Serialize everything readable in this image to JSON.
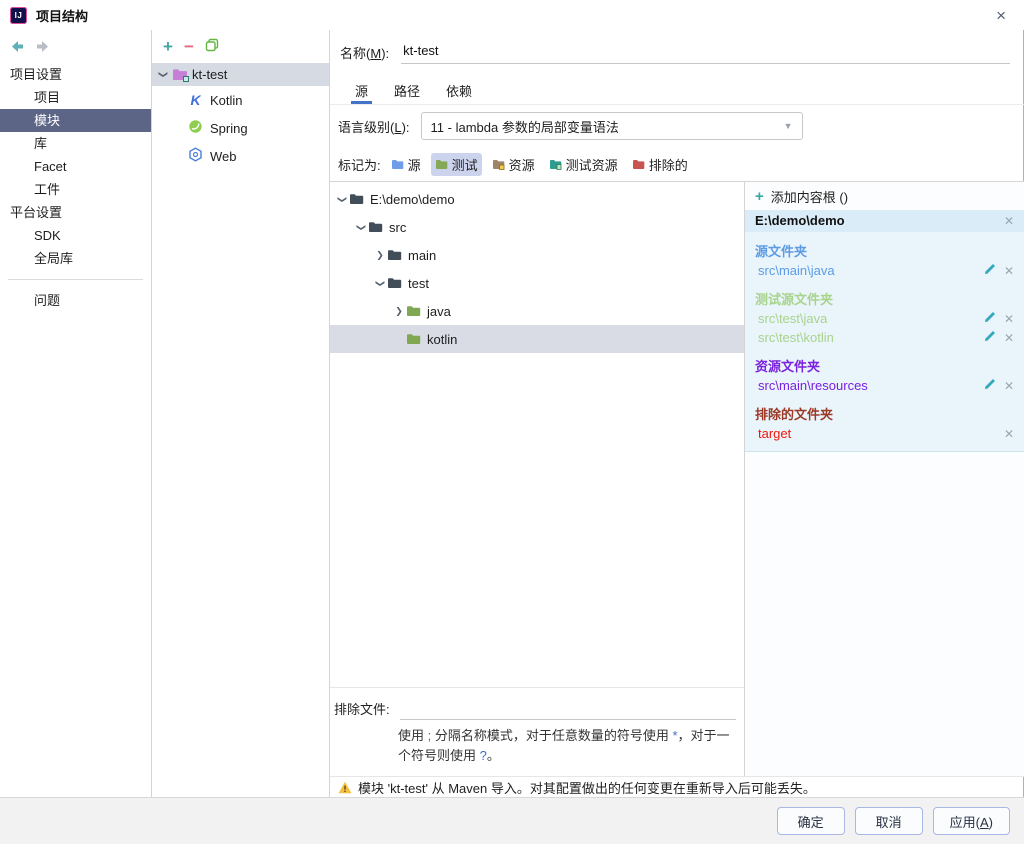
{
  "dialog": {
    "title": "项目结构"
  },
  "sidebar": {
    "sections": [
      {
        "header": "项目设置",
        "items": [
          "项目",
          "模块",
          "库",
          "Facet",
          "工件"
        ]
      },
      {
        "header": "平台设置",
        "items": [
          "SDK",
          "全局库"
        ]
      }
    ],
    "problems": "问题",
    "selected_item": "模块"
  },
  "modules_panel": {
    "root": "kt-test",
    "children": [
      "Kotlin",
      "Spring",
      "Web"
    ]
  },
  "editor": {
    "name_label": {
      "pre": "名称(",
      "mnemonic": "M",
      "post": "):"
    },
    "name_value": "kt-test",
    "tabs": [
      "源",
      "路径",
      "依赖"
    ],
    "active_tab": "源",
    "lang_label": {
      "pre": "语言级别(",
      "mnemonic": "L",
      "post": "):"
    },
    "lang_value": "11 - lambda 参数的局部变量语法",
    "mark_label": "标记为:",
    "chips": [
      "源",
      "测试",
      "资源",
      "测试资源",
      "排除的"
    ],
    "selected_chip": "测试",
    "tree": [
      "E:\\demo\\demo",
      "src",
      "main",
      "test",
      "java",
      "kotlin"
    ],
    "selected_tree_item": "kotlin",
    "exclude_label": "排除文件:",
    "exclude_value": "",
    "help": {
      "p1": "使用 ",
      "s1": ";",
      "p2": " 分隔名称模式，对于任意数量的符号使用 ",
      "s2": "*",
      "p3": "，对于一个符号则使用 ",
      "s3": "?",
      "p4": "。"
    }
  },
  "content_roots": {
    "add_label": "添加内容根 ()",
    "root_path": "E:\\demo\\demo",
    "sections": [
      {
        "title": "源文件夹",
        "items": [
          "src\\main\\java"
        ]
      },
      {
        "title": "测试源文件夹",
        "items": [
          "src\\test\\java",
          "src\\test\\kotlin"
        ]
      },
      {
        "title": "资源文件夹",
        "items": [
          "src\\main\\resources"
        ]
      },
      {
        "title": "排除的文件夹",
        "items": [
          "target"
        ]
      }
    ]
  },
  "warning": {
    "text": "模块 'kt-test' 从 Maven 导入。对其配置做出的任何变更在重新导入后可能丢失。"
  },
  "footer": {
    "ok": "确定",
    "cancel": "取消",
    "apply": {
      "pre": "应用(",
      "mnemonic": "A",
      "post": ")"
    }
  },
  "colors": {
    "tab_accent": "#4273c9",
    "sidebar_selected_bg": "#5c6586",
    "source_blue": "#5d9ce5",
    "test_green": "#a8d48c",
    "resources_purple": "#7a22dd",
    "excluded_title": "#9c3a28",
    "excluded_item_red": "#f3180b",
    "root_header_bg": "#d9ecf8",
    "root_block_bg": "#e9f4fb",
    "warning_yellow": "#f5c042"
  }
}
